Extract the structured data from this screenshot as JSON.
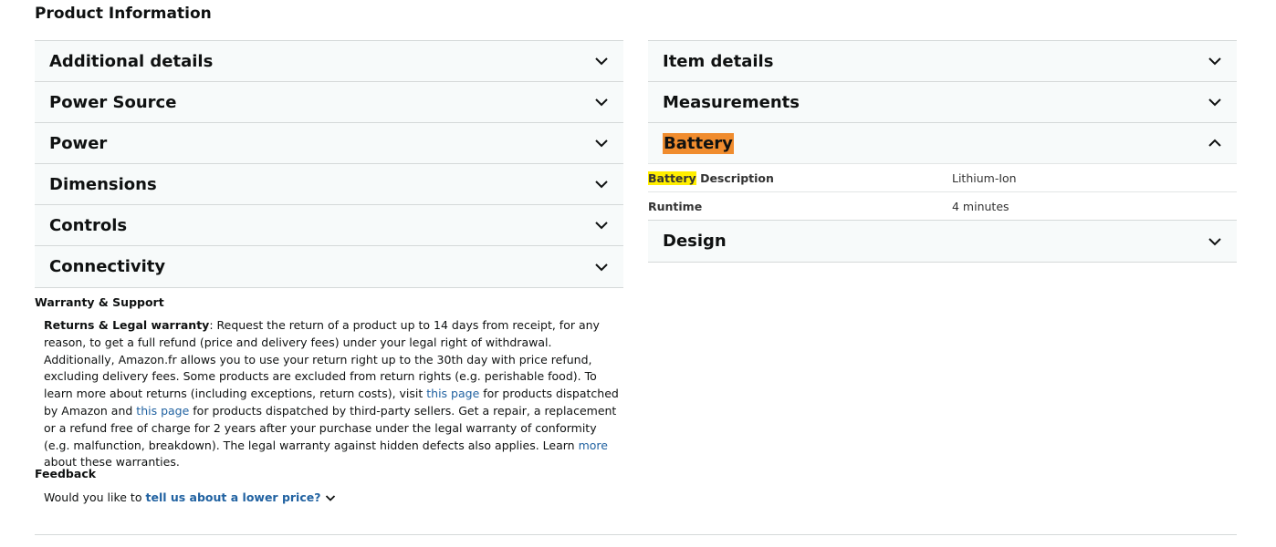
{
  "page_title": "Product Information",
  "left_sections": [
    {
      "label": "Additional details",
      "state": "collapsed"
    },
    {
      "label": "Power Source",
      "state": "collapsed"
    },
    {
      "label": "Power",
      "state": "collapsed"
    },
    {
      "label": "Dimensions",
      "state": "collapsed"
    },
    {
      "label": "Controls",
      "state": "collapsed"
    },
    {
      "label": "Connectivity",
      "state": "collapsed"
    }
  ],
  "right_sections": {
    "item_details": {
      "label": "Item details",
      "state": "collapsed"
    },
    "measurements": {
      "label": "Measurements",
      "state": "collapsed"
    },
    "battery": {
      "label": "Battery",
      "state": "expanded",
      "rows": [
        {
          "key_highlight": "Battery",
          "key_rest": " Description",
          "value": "Lithium-Ion"
        },
        {
          "key": "Runtime",
          "value": "4 minutes"
        }
      ]
    },
    "design": {
      "label": "Design",
      "state": "collapsed"
    }
  },
  "warranty": {
    "heading": "Warranty & Support",
    "title": "Returns & Legal warranty",
    "text_1": ": Request the return of a product up to 14 days from receipt, for any reason, to get a full refund (price and delivery fees) under your legal right of withdrawal. Additionally, Amazon.fr allows you to use your return right up to the 30th day with price refund, excluding delivery fees. Some products are excluded from return rights (e.g. perishable food). To learn more about returns (including exceptions, return costs), visit ",
    "link_1": "this page",
    "text_2": " for products dispatched by Amazon and ",
    "link_2": "this page",
    "text_3": " for products dispatched by third-party sellers. Get a repair, a replacement or a refund free of charge for 2 years after your purchase under the legal warranty of conformity (e.g. malfunction, breakdown). The legal warranty against hidden defects also applies. Learn ",
    "link_3": "more",
    "text_4": " about these warranties."
  },
  "feedback": {
    "heading": "Feedback",
    "prompt": "Would you like to",
    "link": "tell us about a lower price?"
  },
  "colors": {
    "link": "#2162a1",
    "highlight_orange": "#f08c2e",
    "highlight_yellow": "#ffee00"
  },
  "icons": {
    "collapsed": "chevron-down-icon",
    "expanded": "chevron-up-icon"
  }
}
